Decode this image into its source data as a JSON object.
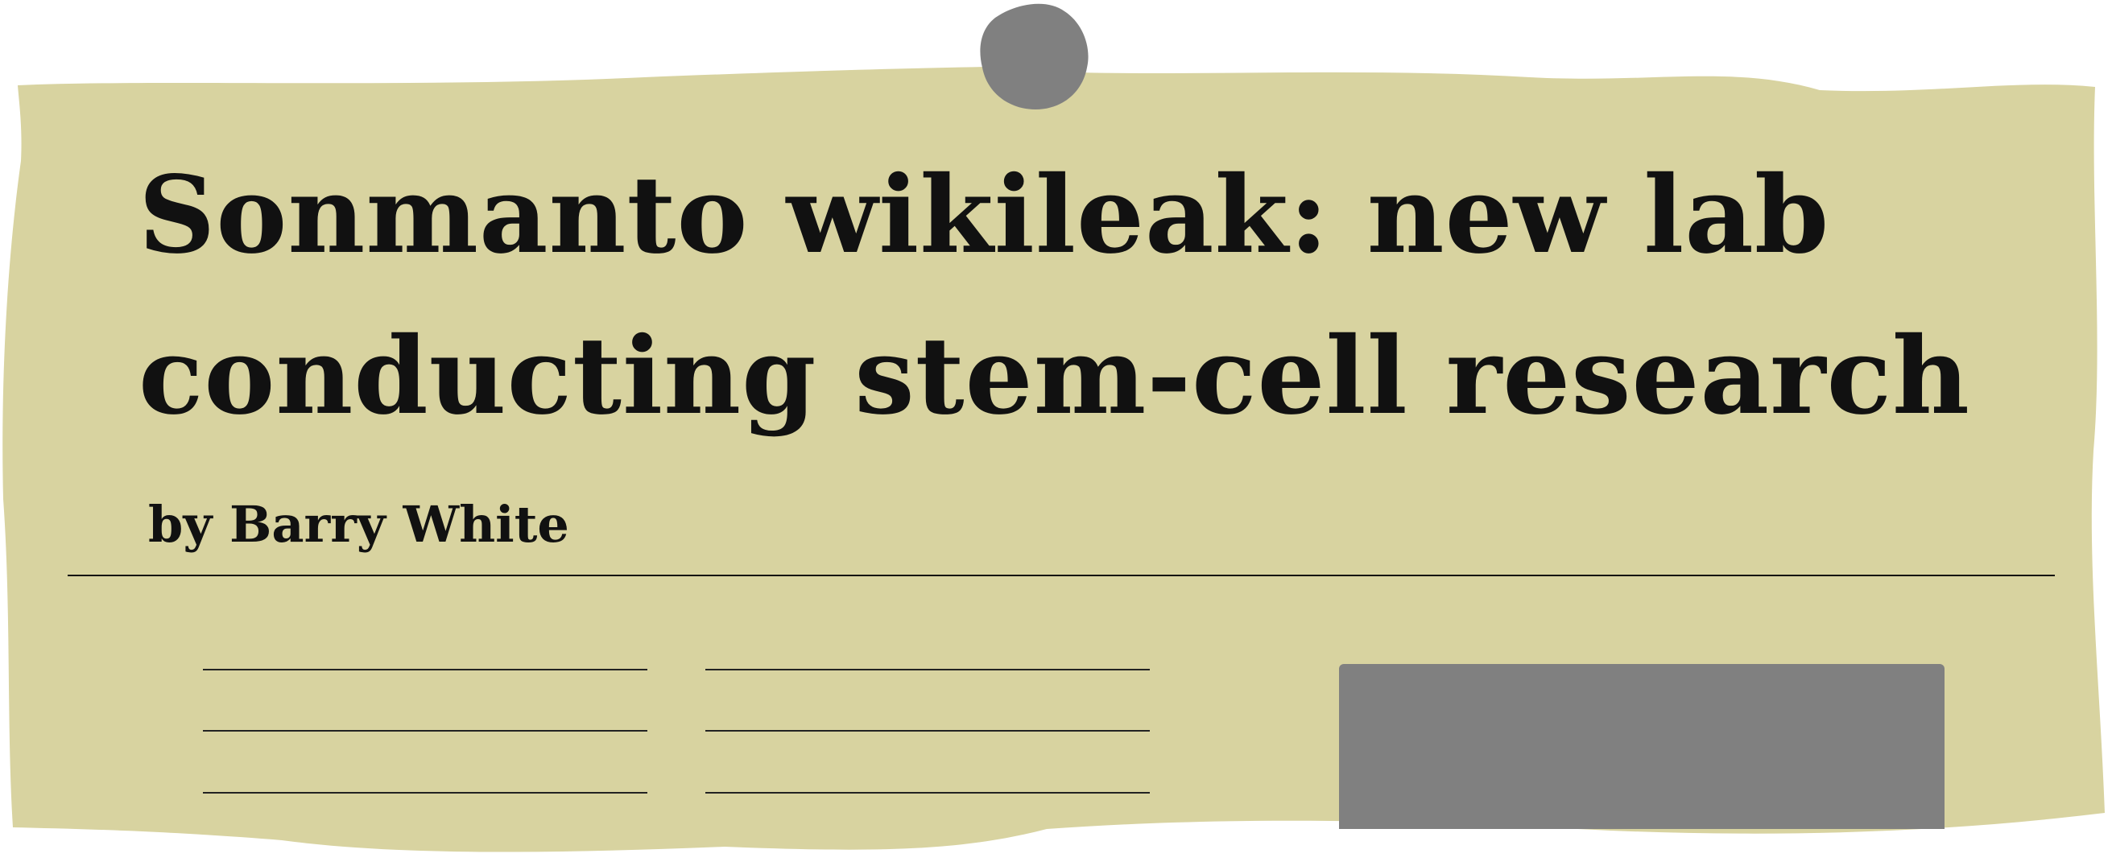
{
  "article": {
    "headline_line1": "Sonmanto wikileak: new lab",
    "headline_line2": "conducting stem-cell research",
    "byline": "by Barry White"
  },
  "colors": {
    "paper": "#d8d3a0",
    "pin": "#808080",
    "photo_placeholder": "#808080",
    "ink": "#111111"
  }
}
